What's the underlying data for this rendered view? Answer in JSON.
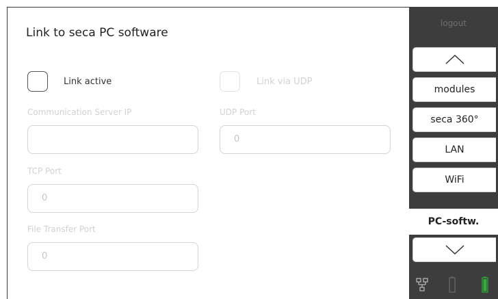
{
  "page": {
    "title": "Link to seca PC software"
  },
  "settings": {
    "link_active_label": "Link active",
    "link_via_udp_label": "Link via UDP",
    "comm_server_ip_label": "Communication Server IP",
    "comm_server_ip_value": "",
    "udp_port_label": "UDP Port",
    "udp_port_value": "0",
    "tcp_port_label": "TCP Port",
    "tcp_port_value": "0",
    "file_transfer_port_label": "File Transfer Port",
    "file_transfer_port_value": "0"
  },
  "sidebar": {
    "logout_label": "logout",
    "items": [
      {
        "label": "modules"
      },
      {
        "label": "seca 360°"
      },
      {
        "label": "LAN"
      },
      {
        "label": "WiFi"
      },
      {
        "label": "PC-softw."
      }
    ],
    "active_item": "PC-softw."
  },
  "status_icons": [
    "network-icon",
    "scale-battery-icon",
    "battery-icon"
  ],
  "colors": {
    "sidebar_bg": "#3d3d3d",
    "battery": "#2fae3a",
    "disabled_text": "#d2d2d2"
  }
}
